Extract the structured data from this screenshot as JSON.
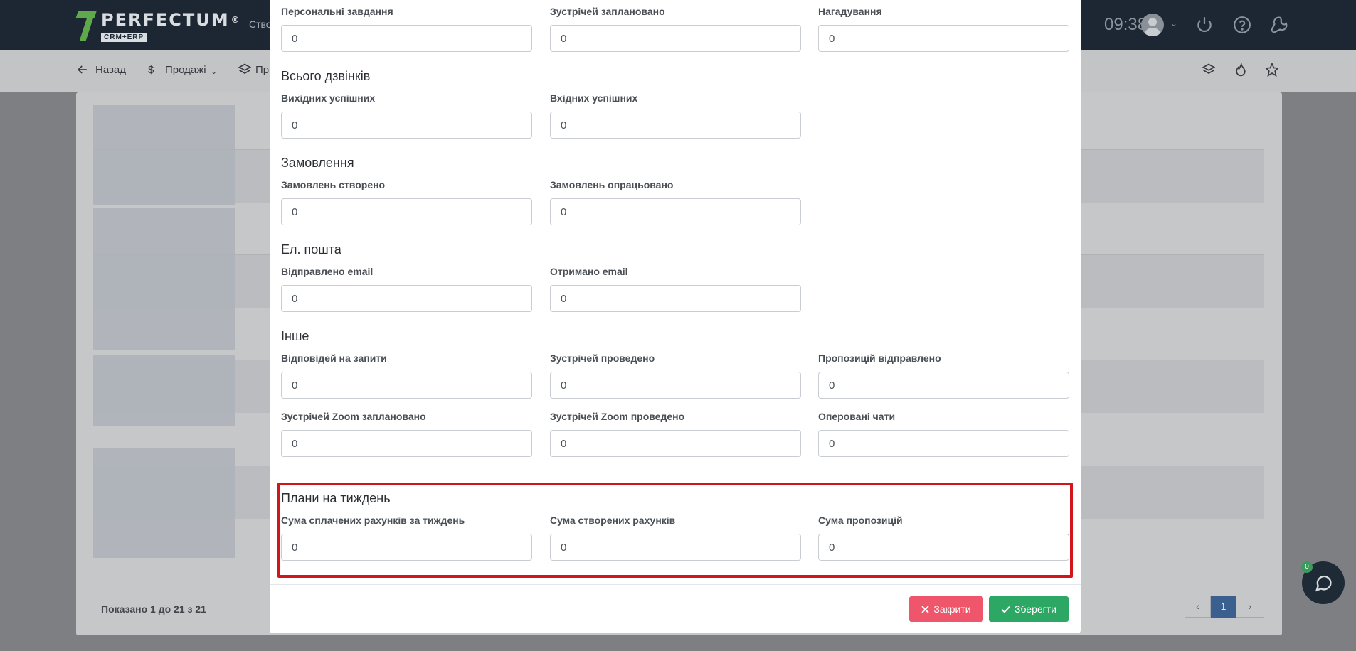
{
  "app": {
    "logo_name": "PERFECTUM",
    "logo_reg": "®",
    "logo_sub": "CRM+ERP",
    "create_label": "Ство",
    "clock": "09:38"
  },
  "subnav": {
    "back_label": "Назад",
    "sales_label": "Продажі",
    "third_label": "Пр"
  },
  "table": {
    "shown_text": "Показано 1 до 21 з 21",
    "current_page": "1"
  },
  "chat": {
    "badge_count": "0"
  },
  "modal": {
    "top_row": [
      {
        "label": "Персональні завдання",
        "value": "0"
      },
      {
        "label": "Зустрічей заплановано",
        "value": "0"
      },
      {
        "label": "Нагадування",
        "value": "0"
      }
    ],
    "calls": {
      "title": "Всього дзвінків",
      "fields": [
        {
          "label": "Вихідних успішних",
          "value": "0"
        },
        {
          "label": "Вхідних успішних",
          "value": "0"
        }
      ]
    },
    "orders": {
      "title": "Замовлення",
      "fields": [
        {
          "label": "Замовлень створено",
          "value": "0"
        },
        {
          "label": "Замовлень опрацьовано",
          "value": "0"
        }
      ]
    },
    "email": {
      "title": "Ел. пошта",
      "fields": [
        {
          "label": "Відправлено email",
          "value": "0"
        },
        {
          "label": "Отримано email",
          "value": "0"
        }
      ]
    },
    "other": {
      "title": "Інше",
      "fields": [
        {
          "label": "Відповідей на запити",
          "value": "0"
        },
        {
          "label": "Зустрічей проведено",
          "value": "0"
        },
        {
          "label": "Пропозицій відправлено",
          "value": "0"
        },
        {
          "label": "Зустрічей Zoom заплановано",
          "value": "0"
        },
        {
          "label": "Зустрічей Zoom проведено",
          "value": "0"
        },
        {
          "label": "Оперовані чати",
          "value": "0"
        }
      ]
    },
    "weekly": {
      "title": "Плани на тиждень",
      "fields": [
        {
          "label": "Сума сплачених рахунків за тиждень",
          "value": "0"
        },
        {
          "label": "Сума створених рахунків",
          "value": "0"
        },
        {
          "label": "Сума пропозицій",
          "value": "0"
        }
      ]
    },
    "buttons": {
      "close_label": "Закрити",
      "save_label": "Зберегти"
    }
  },
  "colors": {
    "highlight": "#d2141b",
    "close_button": "#f0566b",
    "save_button": "#2ca764",
    "topbar": "#1c2733"
  }
}
